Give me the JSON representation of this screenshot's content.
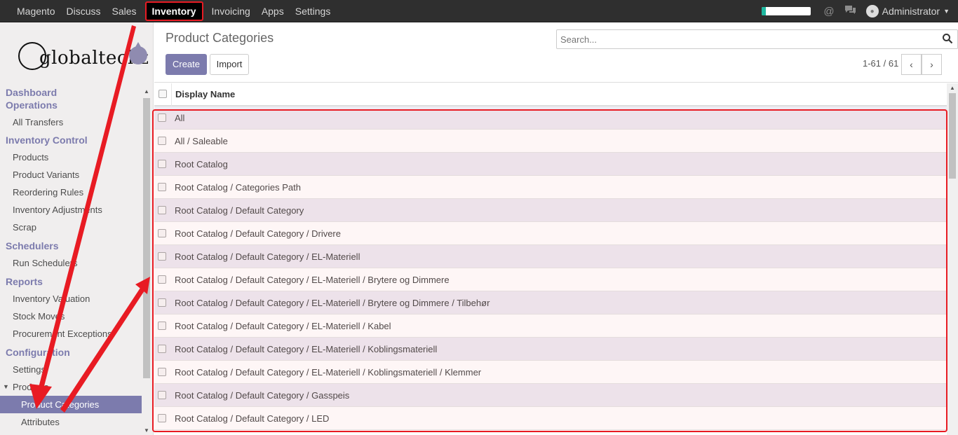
{
  "topbar": {
    "nav": [
      "Magento",
      "Discuss",
      "Sales",
      "Inventory",
      "Invoicing",
      "Apps",
      "Settings"
    ],
    "active": "Inventory",
    "progress": 0.08,
    "user": "Administrator"
  },
  "brand": {
    "logo_text": "globalteckz"
  },
  "sidebar": {
    "sections": [
      {
        "title": "Dashboard Operations",
        "items": [
          "All Transfers"
        ]
      },
      {
        "title": "Inventory Control",
        "items": [
          "Products",
          "Product Variants",
          "Reordering Rules",
          "Inventory Adjustments",
          "Scrap"
        ]
      },
      {
        "title": "Schedulers",
        "items": [
          "Run Schedulers"
        ]
      },
      {
        "title": "Reports",
        "items": [
          "Inventory Valuation",
          "Stock Moves",
          "Procurement Exceptions"
        ]
      },
      {
        "title": "Configuration",
        "items": [
          "Settings",
          "Products"
        ]
      }
    ],
    "sub_items": [
      "Product Categories",
      "Attributes"
    ],
    "active_item": "Product Categories"
  },
  "main": {
    "title": "Product Categories",
    "create_label": "Create",
    "import_label": "Import",
    "search_placeholder": "Search...",
    "pager": "1-61 / 61",
    "column_header": "Display Name",
    "rows": [
      "All",
      "All / Saleable",
      "Root Catalog",
      "Root Catalog / Categories Path",
      "Root Catalog / Default Category",
      "Root Catalog / Default Category / Drivere",
      "Root Catalog / Default Category / EL-Materiell",
      "Root Catalog / Default Category / EL-Materiell / Brytere og Dimmere",
      "Root Catalog / Default Category / EL-Materiell / Brytere og Dimmere / Tilbehør",
      "Root Catalog / Default Category / EL-Materiell / Kabel",
      "Root Catalog / Default Category / EL-Materiell / Koblingsmateriell",
      "Root Catalog / Default Category / EL-Materiell / Koblingsmateriell / Klemmer",
      "Root Catalog / Default Category / Gasspeis",
      "Root Catalog / Default Category / LED"
    ]
  },
  "colors": {
    "accent": "#7c7bad",
    "annotation": "#e81b23",
    "topbar": "#2f2f2f"
  }
}
